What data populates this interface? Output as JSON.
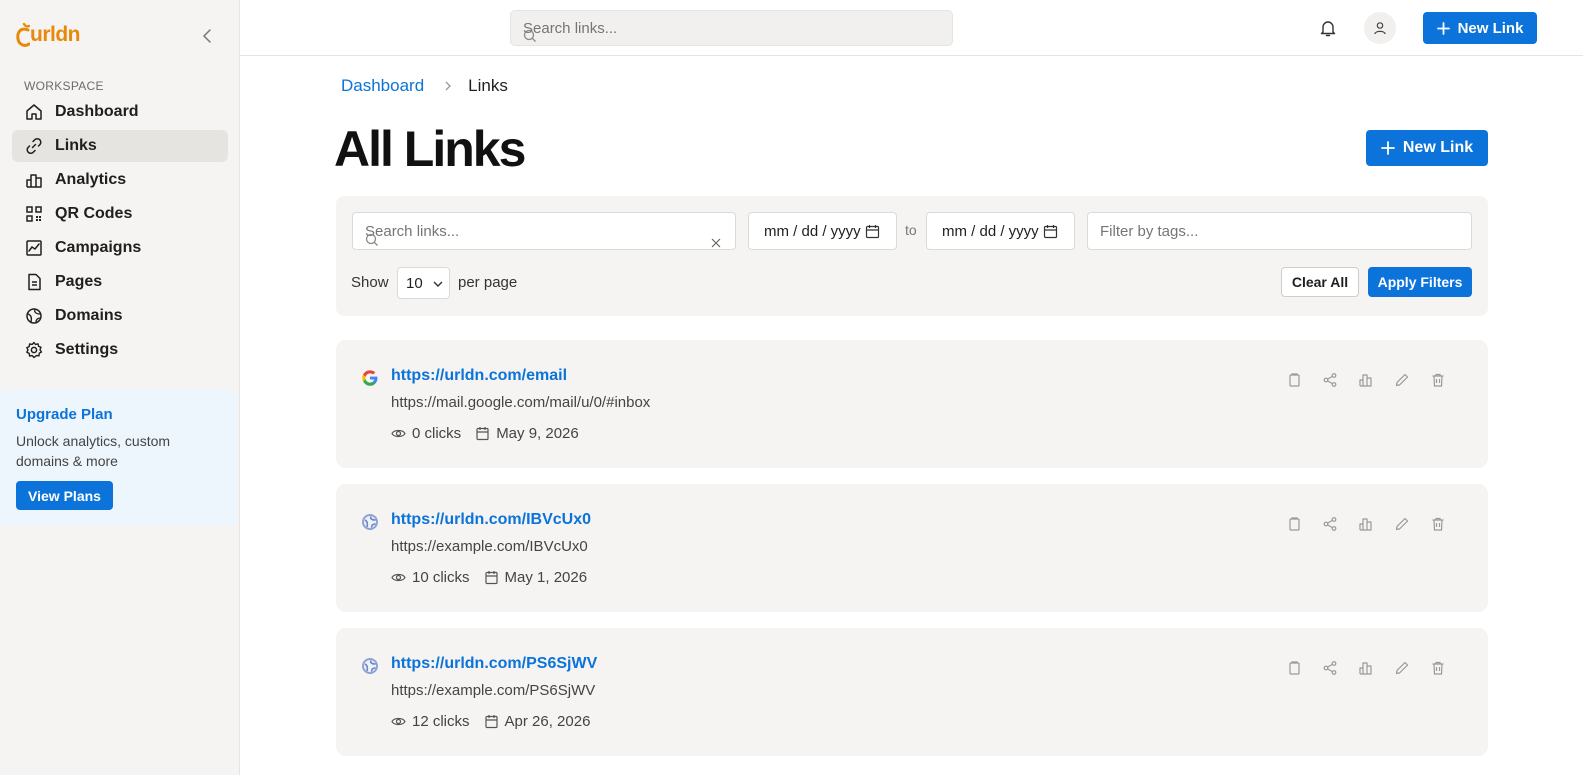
{
  "brand": {
    "name": "urldn",
    "accent": "#0b73d9",
    "logo_color": "#e8890c"
  },
  "sidebar": {
    "section_label": "WORKSPACE",
    "items": [
      {
        "label": "Dashboard",
        "icon": "home-icon"
      },
      {
        "label": "Links",
        "icon": "link-icon",
        "active": true
      },
      {
        "label": "Analytics",
        "icon": "bar-chart-icon"
      },
      {
        "label": "QR Codes",
        "icon": "qr-code-icon"
      },
      {
        "label": "Campaigns",
        "icon": "campaign-icon"
      },
      {
        "label": "Pages",
        "icon": "page-icon"
      },
      {
        "label": "Domains",
        "icon": "globe-icon"
      },
      {
        "label": "Settings",
        "icon": "gear-icon"
      }
    ],
    "upgrade": {
      "title": "Upgrade Plan",
      "description": "Unlock analytics, custom domains & more",
      "button": "View Plans"
    }
  },
  "topbar": {
    "search_placeholder": "Search links...",
    "new_link": "New Link"
  },
  "breadcrumb": {
    "parent": "Dashboard",
    "current": "Links"
  },
  "page": {
    "title": "All Links",
    "new_link": "New Link"
  },
  "filters": {
    "search_placeholder": "Search links...",
    "date_from": "mm / dd / yyyy",
    "date_to": "mm / dd / yyyy",
    "to_label": "to",
    "tags_placeholder": "Filter by tags...",
    "show_label": "Show",
    "per_page_value": "10",
    "per_page_label": "per page",
    "clear": "Clear All",
    "apply": "Apply Filters"
  },
  "links": [
    {
      "short": "https://urldn.com/email",
      "long": "https://mail.google.com/mail/u/0/#inbox",
      "clicks": "0 clicks",
      "date": "May 9, 2026",
      "favicon": "google-icon"
    },
    {
      "short": "https://urldn.com/IBVcUx0",
      "long": "https://example.com/IBVcUx0",
      "clicks": "10 clicks",
      "date": "May 1, 2026",
      "favicon": "globe-icon"
    },
    {
      "short": "https://urldn.com/PS6SjWV",
      "long": "https://example.com/PS6SjWV",
      "clicks": "12 clicks",
      "date": "Apr 26, 2026",
      "favicon": "globe-icon"
    }
  ]
}
